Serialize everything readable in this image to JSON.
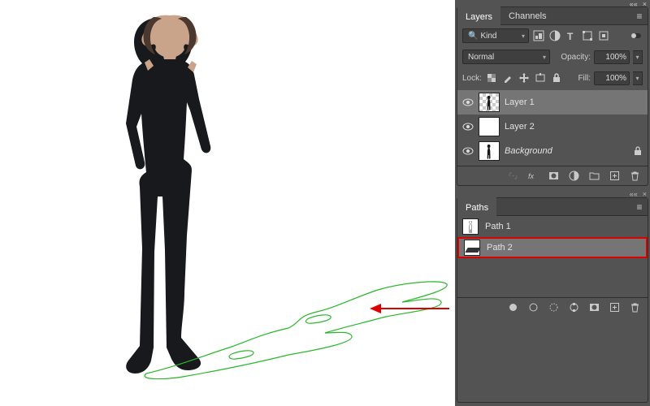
{
  "layers_panel": {
    "tabs": [
      "Layers",
      "Channels"
    ],
    "active_tab": 0,
    "filter_kind": "Kind",
    "blend_mode": "Normal",
    "opacity_label": "Opacity:",
    "opacity_value": "100%",
    "lock_label": "Lock:",
    "fill_label": "Fill:",
    "fill_value": "100%",
    "layers": [
      {
        "name": "Layer 1",
        "visible": true,
        "selected": true,
        "thumb": "checker-figure"
      },
      {
        "name": "Layer 2",
        "visible": true,
        "selected": false,
        "thumb": "white"
      },
      {
        "name": "Background",
        "visible": true,
        "selected": false,
        "thumb": "figure",
        "italic": true,
        "locked": true
      }
    ]
  },
  "paths_panel": {
    "tab": "Paths",
    "paths": [
      {
        "name": "Path 1",
        "selected": false,
        "thumb": "figure-outline"
      },
      {
        "name": "Path 2",
        "selected": true,
        "thumb": "shadow-outline",
        "highlight": true
      }
    ]
  }
}
